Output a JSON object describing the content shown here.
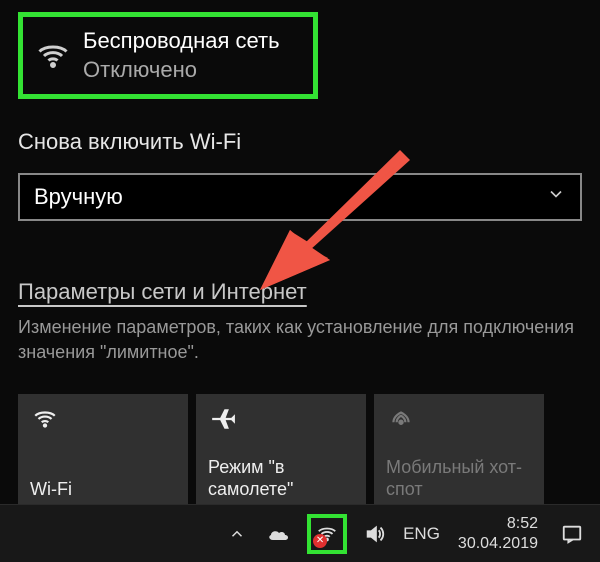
{
  "wireless": {
    "title": "Беспроводная сеть",
    "status": "Отключено"
  },
  "reenable": {
    "label": "Снова включить Wi-Fi",
    "dropdown_value": "Вручную"
  },
  "settings": {
    "link": "Параметры сети и Интернет",
    "description": "Изменение параметров, таких как установление для подключения значения \"лимитное\"."
  },
  "tiles": {
    "wifi": "Wi-Fi",
    "airplane": "Режим \"в самолете\"",
    "hotspot": "Мобильный хот-спот"
  },
  "taskbar": {
    "lang": "ENG",
    "time": "8:52",
    "date": "30.04.2019"
  },
  "colors": {
    "highlight": "#33e233",
    "arrow": "#f05545"
  }
}
